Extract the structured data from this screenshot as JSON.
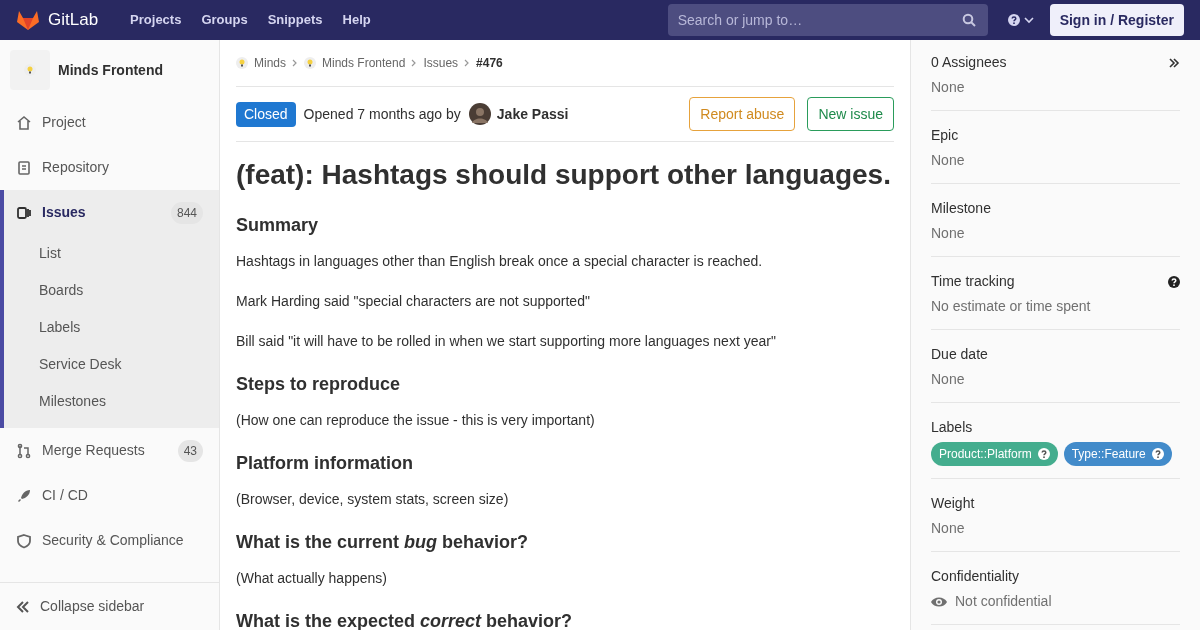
{
  "navbar": {
    "brand": "GitLab",
    "links": [
      "Projects",
      "Groups",
      "Snippets",
      "Help"
    ],
    "search": {
      "placeholder": "Search or jump to…"
    },
    "sign_in": "Sign in / Register"
  },
  "sidebar": {
    "project": "Minds Frontend",
    "items": [
      {
        "label": "Project",
        "selected": false
      },
      {
        "label": "Repository",
        "selected": false
      },
      {
        "label": "Issues",
        "selected": true,
        "count": "844",
        "children": [
          {
            "label": "List"
          },
          {
            "label": "Boards"
          },
          {
            "label": "Labels"
          },
          {
            "label": "Service Desk"
          },
          {
            "label": "Milestones"
          }
        ]
      },
      {
        "label": "Merge Requests",
        "selected": false,
        "count": "43"
      },
      {
        "label": "CI / CD",
        "selected": false
      },
      {
        "label": "Security & Compliance",
        "selected": false
      }
    ],
    "collapse": "Collapse sidebar"
  },
  "breadcrumbs": [
    "Minds",
    "Minds Frontend",
    "Issues",
    "#476"
  ],
  "issue": {
    "status": "Closed",
    "opened": "Opened 7 months ago by",
    "author": "Jake Passi",
    "actions": [
      {
        "label": "Report abuse",
        "kind": "warning"
      },
      {
        "label": "New issue",
        "kind": "success"
      }
    ],
    "title": "(feat): Hashtags should support other languages.",
    "body": [
      {
        "kind": "heading",
        "text": "Summary"
      },
      {
        "kind": "para",
        "text": "Hashtags in languages other than English break once a special character is reached."
      },
      {
        "kind": "para",
        "text": "Mark Harding said \"special characters are not supported\""
      },
      {
        "kind": "para",
        "text": "Bill said \"it will have to be rolled in when we start supporting more languages next year\""
      },
      {
        "kind": "heading",
        "text": "Steps to reproduce"
      },
      {
        "kind": "para",
        "text": "(How one can reproduce the issue - this is very important)"
      },
      {
        "kind": "heading",
        "text": "Platform information"
      },
      {
        "kind": "para",
        "text": "(Browser, device, system stats, screen size)"
      },
      {
        "kind": "heading",
        "text": "What is the current *bug* behavior?"
      },
      {
        "kind": "para",
        "text": "(What actually happens)"
      },
      {
        "kind": "heading",
        "text": "What is the expected *correct* behavior?"
      }
    ]
  },
  "right_sidebar": [
    {
      "title": "0 Assignees",
      "value": "None",
      "kind": "assignees"
    },
    {
      "title": "Epic",
      "value": "None",
      "kind": "plain"
    },
    {
      "title": "Milestone",
      "value": "None",
      "kind": "plain"
    },
    {
      "title": "Time tracking",
      "value": "No estimate or time spent",
      "kind": "help"
    },
    {
      "title": "Due date",
      "value": "None",
      "kind": "plain"
    },
    {
      "title": "Labels",
      "kind": "labels",
      "labels": [
        {
          "text": "Product::Platform",
          "color": "#44ad8e"
        },
        {
          "text": "Type::Feature",
          "color": "#428bca"
        }
      ]
    },
    {
      "title": "Weight",
      "value": "None",
      "kind": "plain"
    },
    {
      "title": "Confidentiality",
      "value": "Not confidential",
      "kind": "confidential"
    }
  ]
}
